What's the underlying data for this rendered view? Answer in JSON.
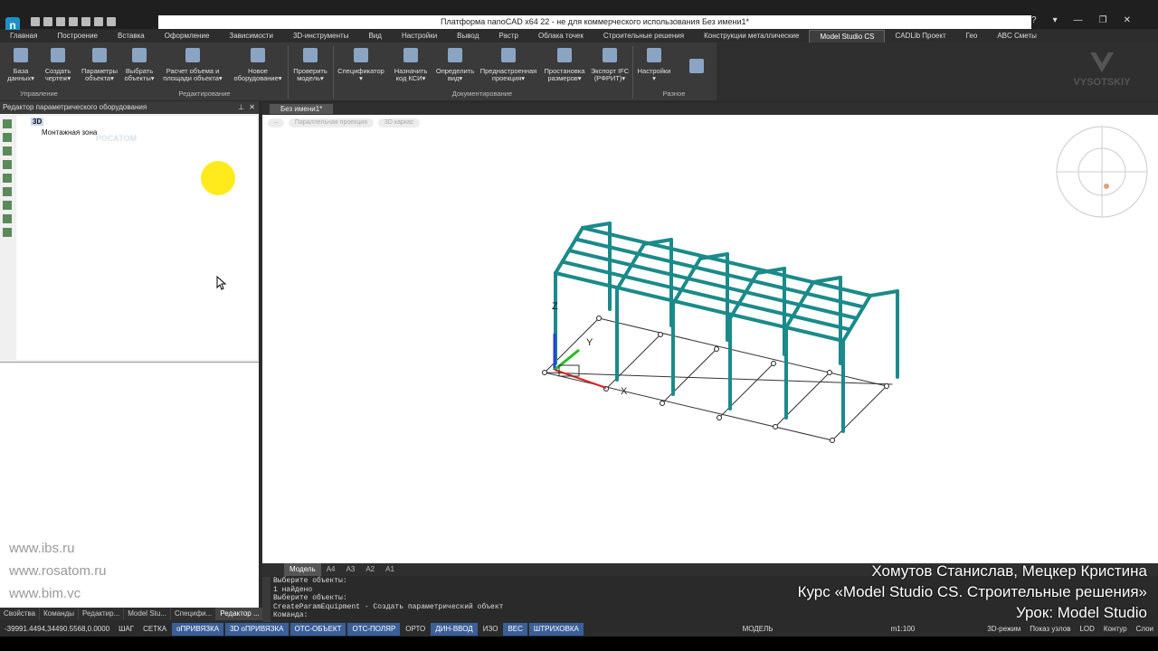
{
  "window": {
    "title": "Платформа nanoCAD x64 22 - не для коммерческого использования Без имени1*",
    "controls": [
      "?",
      "▾",
      "—",
      "❐",
      "✕"
    ]
  },
  "menu_tabs": [
    {
      "label": "Главная",
      "active": false
    },
    {
      "label": "Построение",
      "active": false
    },
    {
      "label": "Вставка",
      "active": false
    },
    {
      "label": "Оформление",
      "active": false
    },
    {
      "label": "Зависимости",
      "active": false
    },
    {
      "label": "3D-инструменты",
      "active": false
    },
    {
      "label": "Вид",
      "active": false
    },
    {
      "label": "Настройки",
      "active": false
    },
    {
      "label": "Вывод",
      "active": false
    },
    {
      "label": "Растр",
      "active": false
    },
    {
      "label": "Облака точек",
      "active": false
    },
    {
      "label": "Строительные решения",
      "active": false
    },
    {
      "label": "Конструкции металлические",
      "active": false
    },
    {
      "label": "Model Studio CS",
      "active": true
    },
    {
      "label": "CADLib Проект",
      "active": false
    },
    {
      "label": "Гео",
      "active": false
    },
    {
      "label": "ABC Сметы",
      "active": false
    }
  ],
  "ribbon": {
    "buttons": [
      {
        "l1": "База",
        "l2": "данных▾"
      },
      {
        "l1": "Создать",
        "l2": "чертеж▾"
      },
      {
        "l1": "Параметры",
        "l2": "объекта▾"
      },
      {
        "l1": "Выбрать",
        "l2": "объекты▾"
      },
      {
        "l1": "Расчет объема и",
        "l2": "площади объекта▾"
      },
      {
        "l1": "Новое",
        "l2": "оборудование▾"
      },
      {
        "l1": "Проверить",
        "l2": "модель▾"
      },
      {
        "l1": "Спецификатор",
        "l2": "▾"
      },
      {
        "l1": "Назначить",
        "l2": "код КСИ▾"
      },
      {
        "l1": "Определить",
        "l2": "вид▾"
      },
      {
        "l1": "Преднастроенная",
        "l2": "проекция▾"
      },
      {
        "l1": "Простановка",
        "l2": "размеров▾"
      },
      {
        "l1": "Экспорт IFC",
        "l2": "(РФРИТ)▾"
      },
      {
        "l1": "Настройки",
        "l2": "▾"
      }
    ],
    "groups": [
      "Управление",
      "Редактирование",
      "Документирование",
      "Разное"
    ],
    "watermark": "VYSOTSKIY"
  },
  "left_panel": {
    "title": "Редактор параметрического оборудования",
    "header_icons": [
      "📌",
      "✕"
    ],
    "tree_root": "3D",
    "tree_child": "Монтажная зона",
    "tree_ghost": "РОСАТОМ",
    "links": [
      "www.ibs.ru",
      "www.rosatom.ru",
      "www.bim.vc"
    ],
    "tabs": [
      {
        "label": "Свойства",
        "active": false
      },
      {
        "label": "Команды",
        "active": false
      },
      {
        "label": "Редактир...",
        "active": false
      },
      {
        "label": "Model Stu...",
        "active": false
      },
      {
        "label": "Специфи...",
        "active": false
      },
      {
        "label": "Редактор ...",
        "active": true
      }
    ]
  },
  "document": {
    "tab": "Без имени1*",
    "viewport_controls": [
      "–",
      "Параллельная проекция",
      "3D каркас"
    ]
  },
  "model_tabs": [
    {
      "label": "Модель",
      "active": true
    },
    {
      "label": "A4",
      "active": false
    },
    {
      "label": "A3",
      "active": false
    },
    {
      "label": "A2",
      "active": false
    },
    {
      "label": "A1",
      "active": false
    }
  ],
  "command_line": [
    "Выберите объекты:",
    "1 найдено",
    "Выберите объекты:",
    "CreateParamEquipment - Создать параметрический объект",
    "Команда:"
  ],
  "axes": {
    "z": "Z",
    "y": "Y",
    "x": "X"
  },
  "credits": [
    "Хомутов Станислав, Мецкер Кристина",
    "Курс «Model Studio CS. Строительные решения»",
    "Урок: Model Studio"
  ],
  "statusbar": {
    "coords": "-39991.4494,34490.5568,0.0000",
    "toggles": [
      {
        "label": "ШАГ",
        "on": false
      },
      {
        "label": "СЕТКА",
        "on": false
      },
      {
        "label": "оПРИВЯЗКА",
        "on": true
      },
      {
        "label": "3D оПРИВЯЗКА",
        "on": true
      },
      {
        "label": "ОТС-ОБЪЕКТ",
        "on": true
      },
      {
        "label": "ОТС-ПОЛЯР",
        "on": true
      },
      {
        "label": "ОРТО",
        "on": false
      },
      {
        "label": "ДИН-ВВОД",
        "on": true
      },
      {
        "label": "ИЗО",
        "on": false
      },
      {
        "label": "ВЕС",
        "on": true
      },
      {
        "label": "ШТРИХОВКА",
        "on": true
      }
    ],
    "right": [
      "МОДЕЛЬ",
      "m1:100",
      "3D-режим",
      "Показ узлов",
      "LOD",
      "Контур",
      "Слои"
    ]
  },
  "colors": {
    "frame": "#1b8a8a",
    "axis_x": "#e02020",
    "axis_y": "#20c020",
    "axis_z": "#2040e0",
    "highlight": "#ffeb1c"
  }
}
